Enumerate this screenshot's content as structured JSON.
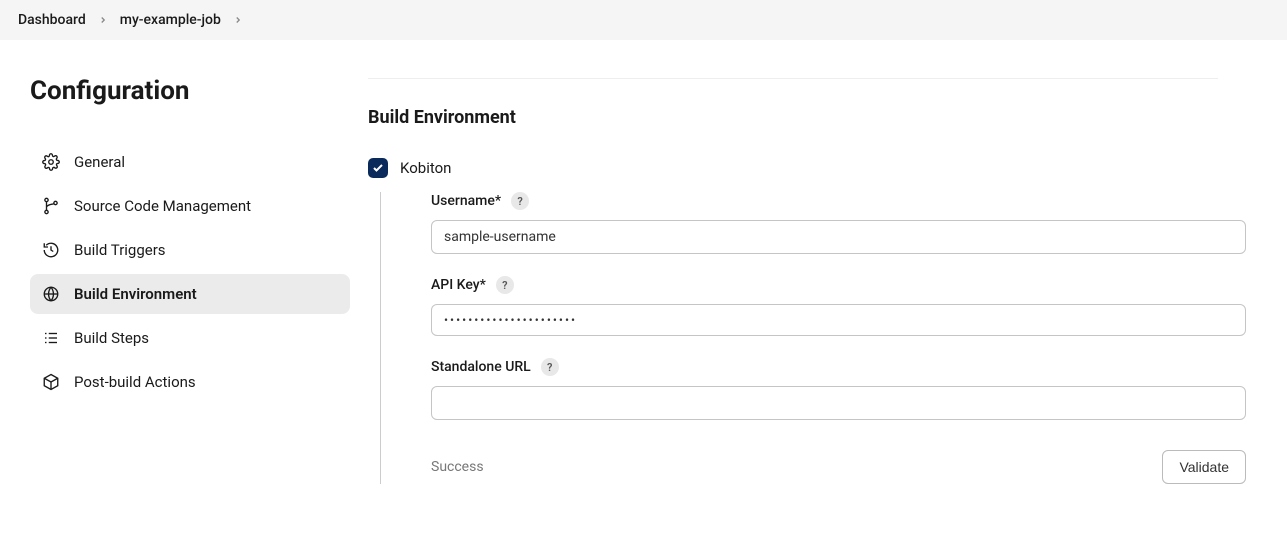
{
  "breadcrumb": {
    "items": [
      "Dashboard",
      "my-example-job"
    ]
  },
  "sidebar": {
    "title": "Configuration",
    "items": [
      {
        "label": "General"
      },
      {
        "label": "Source Code Management"
      },
      {
        "label": "Build Triggers"
      },
      {
        "label": "Build Environment"
      },
      {
        "label": "Build Steps"
      },
      {
        "label": "Post-build Actions"
      }
    ]
  },
  "section": {
    "title": "Build Environment",
    "checkbox_label": "Kobiton",
    "fields": {
      "username": {
        "label": "Username*",
        "value": "sample-username"
      },
      "apikey": {
        "label": "API Key*",
        "value": "••••••••••••••••••••••"
      },
      "standalone_url": {
        "label": "Standalone URL",
        "value": ""
      }
    },
    "status": "Success",
    "validate_label": "Validate"
  }
}
